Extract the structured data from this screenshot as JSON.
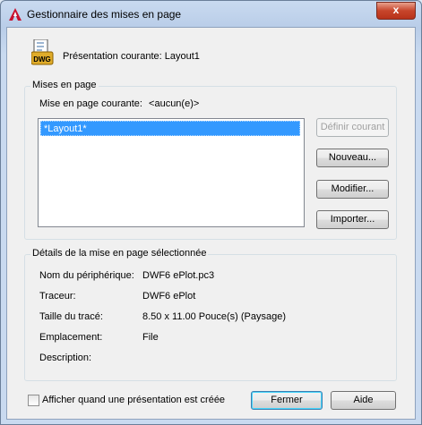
{
  "window": {
    "title": "Gestionnaire des mises en page",
    "close_glyph": "x"
  },
  "header": {
    "current_layout_label": "Présentation courante:",
    "current_layout_value": "Layout1",
    "file_icon_text": "DWG"
  },
  "page_setups": {
    "group_label": "Mises en page",
    "current_label": "Mise en page courante:",
    "current_value": "<aucun(e)>",
    "items": [
      "*Layout1*"
    ]
  },
  "buttons": {
    "set_current": "Définir courant",
    "new": "Nouveau...",
    "modify": "Modifier...",
    "import": "Importer...",
    "close": "Fermer",
    "help": "Aide"
  },
  "details": {
    "group_label": "Détails de la mise en page sélectionnée",
    "rows": [
      {
        "label": "Nom du périphérique:",
        "value": "DWF6 ePlot.pc3"
      },
      {
        "label": "Traceur:",
        "value": "DWF6 ePlot"
      },
      {
        "label": "Taille du tracé:",
        "value": "8.50 x 11.00 Pouce(s) (Paysage)"
      },
      {
        "label": "Emplacement:",
        "value": "File"
      },
      {
        "label": "Description:",
        "value": ""
      }
    ]
  },
  "footer": {
    "show_on_create_label": "Afficher quand une présentation est créée",
    "show_on_create_checked": false
  }
}
